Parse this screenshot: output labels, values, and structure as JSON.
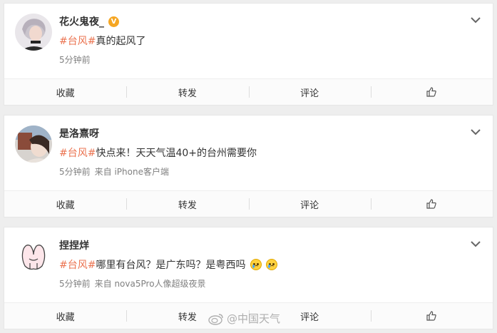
{
  "posts": [
    {
      "username": "花火鬼夜_",
      "verified": true,
      "hashtag": "#台风#",
      "text": "真的起风了",
      "time": "5分钟前",
      "source": ""
    },
    {
      "username": "是洛熹呀",
      "verified": false,
      "hashtag": "#台风#",
      "text": "快点来！天天气温40+的台州需要你",
      "time": "5分钟前",
      "source": "来自 iPhone客户端"
    },
    {
      "username": "捏捏烊",
      "verified": false,
      "hashtag": "#台风#",
      "text": "哪里有台风？是广东吗？是粤西吗",
      "time": "5分钟前",
      "source": "来自 nova5Pro人像超级夜景"
    }
  ],
  "actions": {
    "collect": "收藏",
    "repost": "转发",
    "comment": "评论"
  },
  "watermark": "@中国天气",
  "colors": {
    "hashtag": "#eb7350",
    "verified": "#f5a623"
  }
}
